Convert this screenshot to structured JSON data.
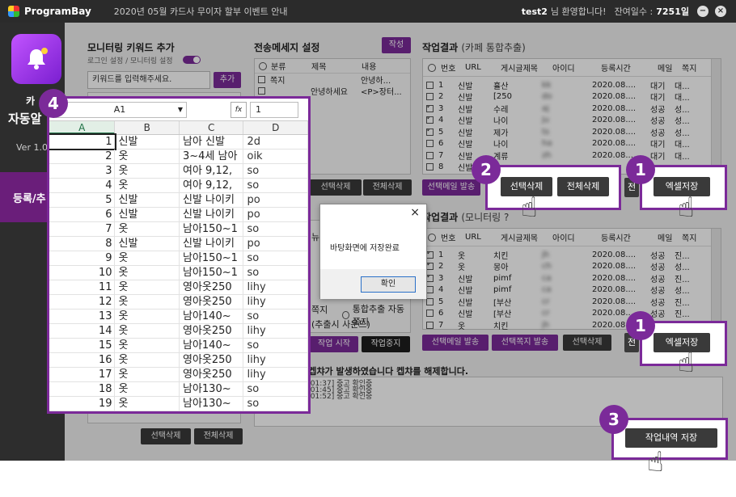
{
  "titlebar": {
    "brand": "ProgramBay",
    "notice": "2020년 05월 카드사 무이자 할부 이벤트 안내",
    "user": "test2",
    "welcome": "님 환영합니다!",
    "days_label": "잔여일수 :",
    "days_value": "7251일",
    "minimize": "−",
    "close": "×"
  },
  "sidebar": {
    "title_a": "카",
    "title_b": "자동알",
    "version": "Ver 1.0",
    "nav_item": "등록/추"
  },
  "keyword": {
    "title": "모니터링 키워드 추가",
    "sub": "로그인 설정 / 모니터링 설정",
    "placeholder": "키워드를 입력해주세요.",
    "add": "추가"
  },
  "transfer": {
    "title": "전송메세지 설정",
    "write": "작성",
    "cols": [
      "분류",
      "제목",
      "내용"
    ],
    "rows": [
      {
        "cat": "쪽지",
        "title": "",
        "content": "안녕하..."
      },
      {
        "cat": "",
        "title": "안녕하세요",
        "content": "<P>장터..."
      }
    ],
    "partial": [
      "뉴",
      "쪽지",
      "(추출시 사운드)"
    ],
    "auto_label": "통합추출 자동쪽지",
    "sel_delete": "선택삭제",
    "all_delete": "전체삭제",
    "start": "작업 시작",
    "stop": "작업중지"
  },
  "results_cafe": {
    "title": "작업결과",
    "subtitle": "(카페 통합추출)",
    "cols": [
      "번호",
      "URL",
      "게시글제목",
      "아이디",
      "등록시간",
      "메일",
      "쪽지"
    ],
    "rows": [
      {
        "n": "1",
        "url": "신발",
        "t": "휼산",
        "id": "kk",
        "time": "2020.08....",
        "mail": "대기",
        "memo": "대..."
      },
      {
        "n": "2",
        "url": "신발",
        "t": "[250",
        "id": "do",
        "time": "2020.08....",
        "mail": "대기",
        "memo": "대..."
      },
      {
        "n": "3",
        "url": "신발",
        "t": "수레",
        "id": "aj",
        "time": "2020.08....",
        "mail": "성공",
        "memo": "성..."
      },
      {
        "n": "4",
        "url": "신발",
        "t": "나이",
        "id": "ju",
        "time": "2020.08....",
        "mail": "성공",
        "memo": "성..."
      },
      {
        "n": "5",
        "url": "신발",
        "t": "제가",
        "id": "ts",
        "time": "2020.08....",
        "mail": "성공",
        "memo": "성..."
      },
      {
        "n": "6",
        "url": "신발",
        "t": "나이",
        "id": "ha",
        "time": "2020.08....",
        "mail": "대기",
        "memo": "대..."
      },
      {
        "n": "7",
        "url": "신발",
        "t": "계류",
        "id": "zh",
        "time": "2020.08....",
        "mail": "대기",
        "memo": "대..."
      },
      {
        "n": "8",
        "url": "신발",
        "t": "",
        "id": "",
        "time": "",
        "mail": "",
        "memo": ""
      }
    ],
    "checked": [
      false,
      false,
      true,
      true,
      true,
      false,
      false,
      false
    ],
    "send_mail": "선택메일 발송"
  },
  "results_monitor": {
    "title": "작업결과",
    "subtitle": "(모니터링 ?",
    "cols": [
      "번호",
      "URL",
      "게시글제목",
      "아이디",
      "등록시간",
      "메일",
      "쪽지"
    ],
    "rows": [
      {
        "n": "1",
        "url": "옷",
        "t": "치킨",
        "id": "jh",
        "time": "2020.08....",
        "mail": "성공",
        "memo": "진..."
      },
      {
        "n": "2",
        "url": "옷",
        "t": "몽아",
        "id": "ch",
        "time": "2020.08....",
        "mail": "성공",
        "memo": "성..."
      },
      {
        "n": "3",
        "url": "신발",
        "t": "pimf",
        "id": "ca",
        "time": "2020.08....",
        "mail": "성공",
        "memo": "진..."
      },
      {
        "n": "4",
        "url": "신발",
        "t": "pimf",
        "id": "ca",
        "time": "2020.08....",
        "mail": "성공",
        "memo": "성..."
      },
      {
        "n": "5",
        "url": "신발",
        "t": "[부산",
        "id": "cr",
        "time": "2020.08....",
        "mail": "성공",
        "memo": "진..."
      },
      {
        "n": "6",
        "url": "신발",
        "t": "[부산",
        "id": "cr",
        "time": "2020.08....",
        "mail": "성공",
        "memo": "진..."
      },
      {
        "n": "7",
        "url": "옷",
        "t": "치킨",
        "id": "jh",
        "time": "2020.08....",
        "mail": "성공",
        "memo": "진..."
      }
    ],
    "checked": [
      true,
      true,
      true,
      false,
      false,
      false,
      false
    ],
    "send_mail": "선택메일 발송",
    "send_memo": "선택쪽지 발송",
    "sel_delete": "선택삭제"
  },
  "log": {
    "header": "쪽지 발송중 켑챠가 발생하였습니다 켑챠를 해제합니다.",
    "lines": [
      "3:01:37] 중고         확인중",
      "3:01:45] 중고         확인중",
      "3:01:52] 중고         확인중"
    ]
  },
  "excel": {
    "cell_ref": "A1",
    "fx": "fx",
    "value": "1",
    "cols": [
      "A",
      "B",
      "C",
      "D"
    ],
    "rows": [
      [
        "1",
        "신발",
        "남아 신발",
        "2d"
      ],
      [
        "2",
        "옷",
        "3~4세 남아",
        "oik"
      ],
      [
        "3",
        "옷",
        "여아 9,12,",
        "so"
      ],
      [
        "4",
        "옷",
        "여아 9,12,",
        "so"
      ],
      [
        "5",
        "신발",
        "신발 나이키",
        "po"
      ],
      [
        "6",
        "신발",
        "신발 나이키",
        "po"
      ],
      [
        "7",
        "옷",
        "남아150~1",
        "so"
      ],
      [
        "8",
        "신발",
        "신발 나이키",
        "po"
      ],
      [
        "9",
        "옷",
        "남아150~1",
        "so"
      ],
      [
        "10",
        "옷",
        "남아150~1",
        "so"
      ],
      [
        "11",
        "옷",
        "영아옷250",
        "lihy"
      ],
      [
        "12",
        "옷",
        "영아옷250",
        "lihy"
      ],
      [
        "13",
        "옷",
        "남아140~",
        "so"
      ],
      [
        "14",
        "옷",
        "영아옷250",
        "lihy"
      ],
      [
        "15",
        "옷",
        "남아140~",
        "so"
      ],
      [
        "16",
        "옷",
        "영아옷250",
        "lihy"
      ],
      [
        "17",
        "옷",
        "영아옷250",
        "lihy"
      ],
      [
        "18",
        "옷",
        "남아130~",
        "so"
      ],
      [
        "19",
        "옷",
        "남아130~",
        "so"
      ]
    ]
  },
  "dialog": {
    "message": "바탕화면에 저장완료",
    "ok": "확인",
    "close": "×"
  },
  "bottom": {
    "sel_delete": "선택삭제",
    "all_delete": "전체삭제"
  },
  "callouts": {
    "b1": "1",
    "b2": "2",
    "b3": "3",
    "b4": "4",
    "excel_save": "엑셀저장",
    "sel_delete": "선택삭제",
    "all_delete": "전체삭제",
    "job_save": "작업내역 저장",
    "cut1": "전",
    "cut2": "전"
  }
}
